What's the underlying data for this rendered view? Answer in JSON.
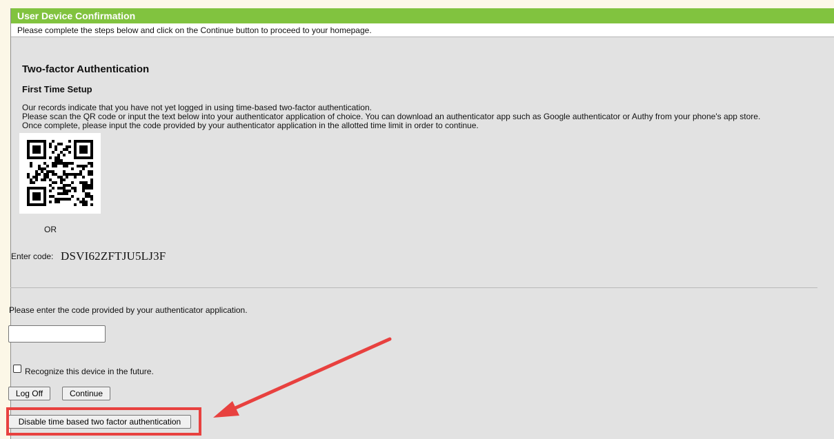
{
  "header": {
    "title": "User Device Confirmation",
    "instructions": "Please complete the steps below and click on the Continue button to proceed to your homepage."
  },
  "main": {
    "section_title": "Two-factor Authentication",
    "sub_title": "First Time Setup",
    "description_lines": [
      "Our records indicate that you have not yet logged in using time-based two-factor authentication.",
      "Please scan the QR code or input the text below into your authenticator application of choice. You can download an authenticator app such as Google authenticator or Authy from your phone's app store.",
      "Once complete, please input the code provided by your authenticator application in the allotted time limit in order to continue."
    ],
    "or_text": "OR",
    "enter_code_label": "Enter code:",
    "enter_code_value": "DSVI62ZFTJU5LJ3F",
    "prompt": "Please enter the code provided by your authenticator application.",
    "code_input_value": "",
    "recognize_label": "Recognize this device in the future.",
    "recognize_checked": false
  },
  "buttons": {
    "log_off": "Log Off",
    "continue": "Continue",
    "disable_2fa": "Disable time based two factor authentication"
  },
  "annotation": {
    "highlight_color": "#e8413f"
  },
  "colors": {
    "header_green": "#81c33f",
    "panel_gray": "#e2e2e2"
  }
}
